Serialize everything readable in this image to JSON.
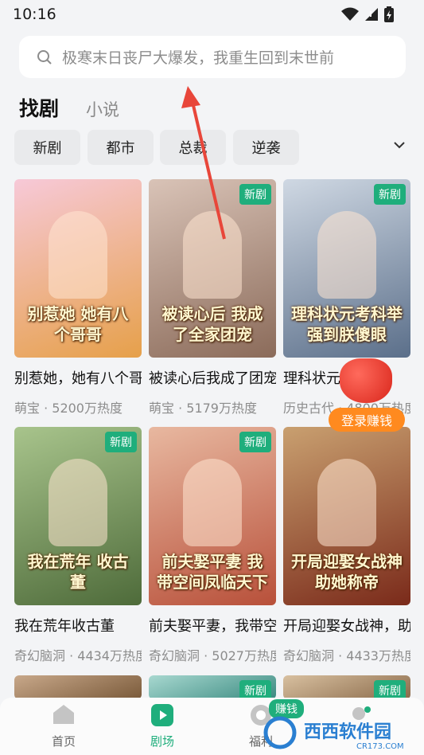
{
  "status_bar": {
    "time": "10:16"
  },
  "search": {
    "placeholder": "极寒末日丧尸大爆发，我重生回到末世前"
  },
  "tabs": {
    "main": "找剧",
    "secondary": "小说"
  },
  "chips": [
    "新剧",
    "都市",
    "总裁",
    "逆袭"
  ],
  "badge_label": "新剧",
  "cards": [
    {
      "title": "别惹她，她有八个哥哥",
      "meta": "萌宝 · 5200万热度",
      "poster_text": "别惹她 她有八个哥哥",
      "colors": [
        "#f7c9d8",
        "#e6a04a"
      ]
    },
    {
      "title": "被读心后我成了团宠",
      "meta": "萌宝 · 5179万热度",
      "poster_text": "被读心后 我成了全家团宠",
      "colors": [
        "#d9c3b7",
        "#8b6b5a"
      ]
    },
    {
      "title": "理科状元考科举",
      "meta": "历史古代 · 4800万热度",
      "poster_text": "理科状元考科举 强到朕傻眼",
      "colors": [
        "#cfd8e3",
        "#5b6f8a"
      ]
    },
    {
      "title": "我在荒年收古董",
      "meta": "奇幻脑洞 · 4434万热度",
      "poster_text": "我在荒年 收古董",
      "colors": [
        "#a8c48c",
        "#4e6b3a"
      ]
    },
    {
      "title": "前夫娶平妻，我带空间凤临天下",
      "meta": "奇幻脑洞 · 5027万热度",
      "poster_text": "前夫娶平妻 我带空间凤临天下",
      "colors": [
        "#e8b8a0",
        "#b8503a"
      ]
    },
    {
      "title": "开局迎娶女战神，助她称帝",
      "meta": "奇幻脑洞 · 4433万热度",
      "poster_text": "开局迎娶女战神 助她称帝",
      "colors": [
        "#c9a070",
        "#7a2a1a"
      ]
    },
    {
      "title": "",
      "meta": "",
      "poster_text": "",
      "colors": [
        "#c8a88a",
        "#7a5a3a"
      ]
    },
    {
      "title": "",
      "meta": "",
      "poster_text": "",
      "colors": [
        "#a8d8d0",
        "#3a8a80"
      ]
    },
    {
      "title": "",
      "meta": "",
      "poster_text": "",
      "colors": [
        "#d8c0a0",
        "#8a6a4a"
      ]
    }
  ],
  "reward": {
    "label": "登录赚钱"
  },
  "bottom_nav": {
    "items": [
      {
        "label": "首页",
        "active": false
      },
      {
        "label": "剧场",
        "active": true
      },
      {
        "label": "福利",
        "active": false
      },
      {
        "label": "",
        "active": false
      }
    ],
    "earn_badge": "赚钱"
  },
  "watermark": {
    "text": "西西软件园",
    "sub": "CR173.COM"
  },
  "colors": {
    "accent": "#1fae7c",
    "annotation_arrow": "#e8463a",
    "reward": "#ff8a1f"
  }
}
